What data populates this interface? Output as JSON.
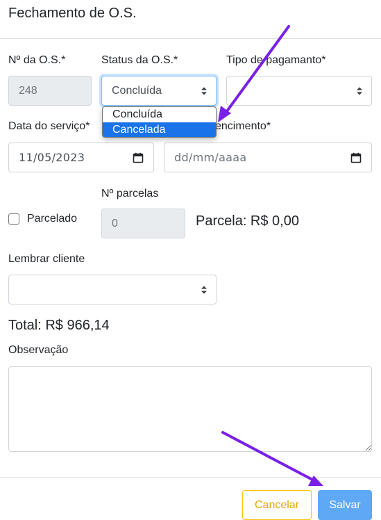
{
  "modal": {
    "title": "Fechamento de O.S."
  },
  "form": {
    "os_number": {
      "label": "Nº da O.S.*",
      "value": "248"
    },
    "status": {
      "label": "Status da O.S.*",
      "value": "Concluída",
      "options": [
        "Concluída",
        "Cancelada"
      ],
      "highlighted_option": "Cancelada"
    },
    "payment_type": {
      "label": "Tipo de pagamanto*",
      "value": ""
    },
    "service_date": {
      "label": "Data do serviço*",
      "value": "11/05/2023"
    },
    "due_date": {
      "label_visible": "encimento*",
      "placeholder": "dd/mm/aaaa"
    },
    "installments_checkbox": {
      "label": "Parcelado",
      "checked": false
    },
    "installments_count": {
      "label": "Nº parcelas",
      "value": "0"
    },
    "installment_value": "Parcela: R$ 0,00",
    "remind_client": {
      "label": "Lembrar cliente",
      "value": ""
    },
    "total": "Total: R$ 966,14",
    "observation": {
      "label": "Observação",
      "value": ""
    }
  },
  "footer": {
    "cancel_label": "Cancelar",
    "save_label": "Salvar"
  },
  "annotations": {
    "arrow_color": "#7a1fe8"
  },
  "colors": {
    "selected_option_bg": "#1a73e8",
    "cancel_border": "#ffc107",
    "save_bg": "#5ea8f5",
    "focus_border": "#80bdff"
  }
}
